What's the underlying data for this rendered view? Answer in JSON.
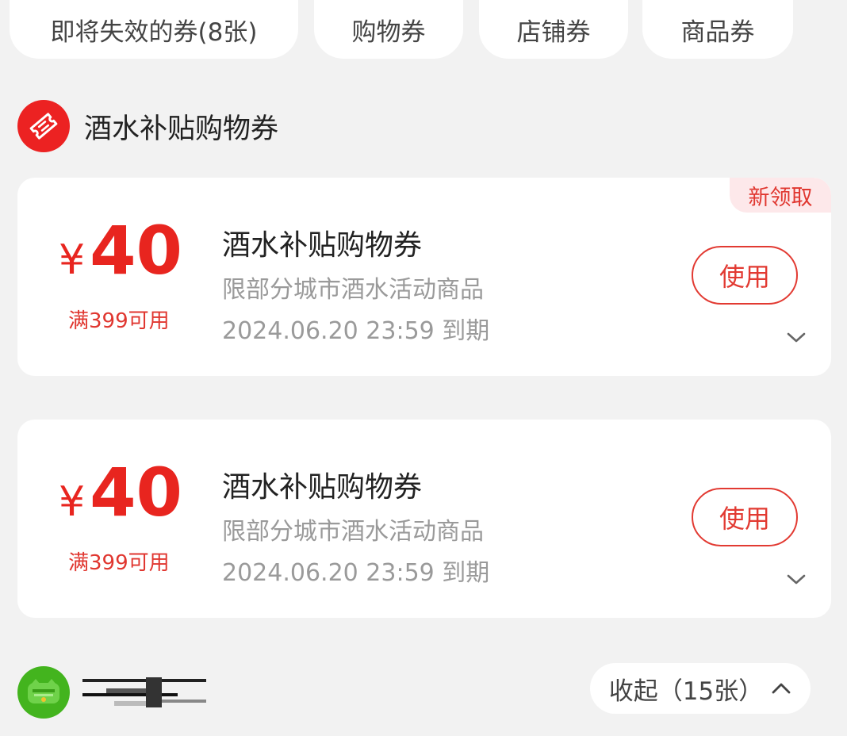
{
  "filters": [
    {
      "label": "即将失效的券(8张)"
    },
    {
      "label": "购物券"
    },
    {
      "label": "店铺券"
    },
    {
      "label": "商品券"
    }
  ],
  "section": {
    "title": "酒水补贴购物券",
    "icon": "coupon-ticket-icon"
  },
  "coupons": [
    {
      "badge": "新领取",
      "currency": "¥",
      "amount": "40",
      "condition": "满399可用",
      "title": "酒水补贴购物券",
      "scope": "限部分城市酒水活动商品",
      "expiry": "2024.06.20 23:59 到期",
      "action": "使用"
    },
    {
      "currency": "¥",
      "amount": "40",
      "condition": "满399可用",
      "title": "酒水补贴购物券",
      "scope": "限部分城市酒水活动商品",
      "expiry": "2024.06.20 23:59 到期",
      "action": "使用"
    }
  ],
  "footer": {
    "store_icon": "store-logo-icon",
    "collapse_label": "收起（15张）"
  },
  "colors": {
    "accent": "#e8251f",
    "badge_bg": "#fde8ea",
    "background": "#f2f2f2",
    "store_green": "#43b41e"
  }
}
